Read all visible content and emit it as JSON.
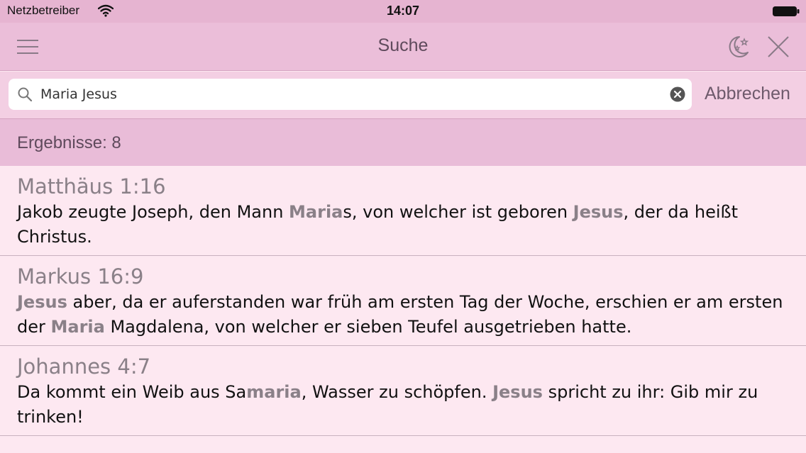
{
  "status_bar": {
    "carrier": "Netzbetreiber",
    "time": "14:07"
  },
  "nav_bar": {
    "title": "Suche"
  },
  "search": {
    "query": "Maria Jesus",
    "cancel_label": "Abbrechen"
  },
  "results_header": {
    "label": "Ergebnisse: 8"
  },
  "results": [
    {
      "reference": "Matthäus 1:16",
      "segments": [
        {
          "t": "Jakob zeugte Joseph, den Mann "
        },
        {
          "t": "Maria",
          "b": true
        },
        {
          "t": "s, von welcher ist geboren "
        },
        {
          "t": "Jesus",
          "b": true
        },
        {
          "t": ", der da heißt Christus."
        }
      ]
    },
    {
      "reference": "Markus 16:9",
      "segments": [
        {
          "t": "Jesus",
          "b": true
        },
        {
          "t": " aber, da er auferstanden war früh am ersten Tag der Woche, erschien er am ersten der "
        },
        {
          "t": "Maria",
          "b": true
        },
        {
          "t": " Magdalena, von welcher er sieben Teufel ausgetrieben hatte."
        }
      ]
    },
    {
      "reference": "Johannes 4:7",
      "segments": [
        {
          "t": "Da kommt ein Weib aus Sa"
        },
        {
          "t": "maria",
          "b": true
        },
        {
          "t": ", Wasser zu schöpfen. "
        },
        {
          "t": "Jesus",
          "b": true
        },
        {
          "t": " spricht zu ihr: Gib mir zu trinken!"
        }
      ]
    }
  ],
  "colors": {
    "nav_background": "#ebbed9",
    "results_header_background": "#e9bcd8",
    "list_background": "#fde8f1",
    "highlight_text": "#8a8088"
  }
}
